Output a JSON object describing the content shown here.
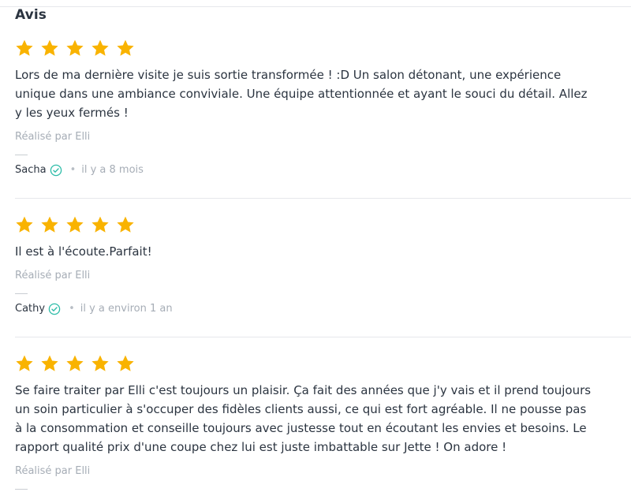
{
  "reviews_section": {
    "title": "Avis"
  },
  "colors": {
    "star": "#f9b300",
    "verified": "#2dbca8",
    "divider": "#e6e8eb"
  },
  "reviews": [
    {
      "rating": 5,
      "text": "Lors de ma dernière visite je suis sortie transformée ! :D Un salon détonant, une expérience unique dans une ambiance conviviale. Une équipe attentionnée et ayant le souci du détail. Allez y les yeux fermés !",
      "performer": "Réalisé par Elli",
      "author": "Sacha",
      "date": "il y a 8 mois"
    },
    {
      "rating": 5,
      "text": "Il est à l'écoute.Parfait!",
      "performer": "Réalisé par Elli",
      "author": "Cathy",
      "date": "il y a environ 1 an"
    },
    {
      "rating": 5,
      "text": "Se faire traiter par Elli c'est toujours un plaisir. Ça fait des années que j'y vais et il prend toujours un soin particulier à s'occuper des fidèles clients aussi, ce qui est fort agréable. Il ne pousse pas à la consommation et conseille toujours avec justesse tout en écoutant les envies et besoins. Le rapport qualité prix d'une coupe chez lui est juste imbattable sur Jette ! On adore !",
      "performer": "Réalisé par Elli"
    }
  ]
}
